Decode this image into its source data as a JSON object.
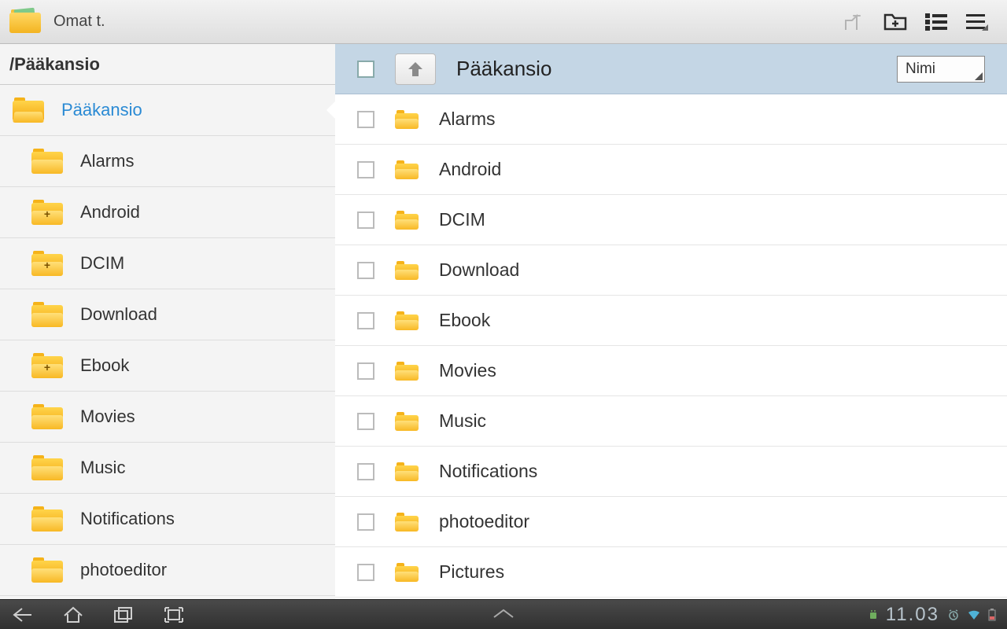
{
  "topbar": {
    "title": "Omat t."
  },
  "sidebar": {
    "path": "/Pääkansio",
    "items": [
      {
        "label": "Pääkansio",
        "open": true,
        "selected": true,
        "indent": 0
      },
      {
        "label": "Alarms",
        "open": false,
        "selected": false,
        "indent": 1
      },
      {
        "label": "Android",
        "open": false,
        "selected": false,
        "indent": 1,
        "plus": true
      },
      {
        "label": "DCIM",
        "open": false,
        "selected": false,
        "indent": 1,
        "plus": true
      },
      {
        "label": "Download",
        "open": false,
        "selected": false,
        "indent": 1
      },
      {
        "label": "Ebook",
        "open": false,
        "selected": false,
        "indent": 1,
        "plus": true
      },
      {
        "label": "Movies",
        "open": false,
        "selected": false,
        "indent": 1
      },
      {
        "label": "Music",
        "open": false,
        "selected": false,
        "indent": 1
      },
      {
        "label": "Notifications",
        "open": false,
        "selected": false,
        "indent": 1
      },
      {
        "label": "photoeditor",
        "open": false,
        "selected": false,
        "indent": 1
      }
    ]
  },
  "main": {
    "header_title": "Pääkansio",
    "sort_label": "Nimi",
    "items": [
      {
        "name": "Alarms"
      },
      {
        "name": "Android"
      },
      {
        "name": "DCIM"
      },
      {
        "name": "Download"
      },
      {
        "name": "Ebook"
      },
      {
        "name": "Movies"
      },
      {
        "name": "Music"
      },
      {
        "name": "Notifications"
      },
      {
        "name": "photoeditor"
      },
      {
        "name": "Pictures"
      }
    ]
  },
  "statusbar": {
    "time": "11.03"
  }
}
